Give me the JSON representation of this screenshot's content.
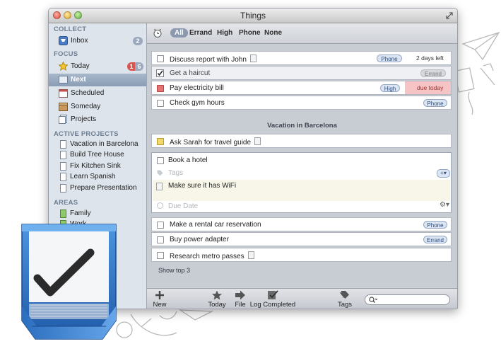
{
  "window": {
    "title": "Things"
  },
  "sidebar": {
    "collect_header": "COLLECT",
    "inbox": {
      "label": "Inbox",
      "count": "2"
    },
    "focus_header": "FOCUS",
    "today": {
      "label": "Today",
      "overdue": "1",
      "count": "6"
    },
    "next": {
      "label": "Next"
    },
    "scheduled": {
      "label": "Scheduled"
    },
    "someday": {
      "label": "Someday"
    },
    "projects": {
      "label": "Projects"
    },
    "active_projects_header": "ACTIVE PROJECTS",
    "active_projects": [
      "Vacation in Barcelona",
      "Build Tree House",
      "Fix Kitchen Sink",
      "Learn Spanish",
      "Prepare Presentation"
    ],
    "areas_header": "AREAS",
    "areas": [
      "Family",
      "Work"
    ]
  },
  "filters": {
    "all": "All",
    "errand": "Errand",
    "high": "High",
    "phone": "Phone",
    "none": "None"
  },
  "tasks": [
    {
      "title": "Discuss report with John",
      "tag": "Phone",
      "due": "2 days left"
    },
    {
      "title": "Get a haircut",
      "tag": "Errand",
      "checked": true
    },
    {
      "title": "Pay electricity bill",
      "tag": "High",
      "due": "due today"
    },
    {
      "title": "Check gym hours",
      "tag": "Phone"
    }
  ],
  "group_title": "Vacation in Barcelona",
  "group_tasks": [
    {
      "title": "Ask Sarah for travel guide"
    }
  ],
  "expanded_task": {
    "title": "Book a hotel",
    "tags_placeholder": "Tags",
    "note": "Make sure it has WiFi",
    "due_placeholder": "Due Date"
  },
  "more_tasks": [
    {
      "title": "Make a rental car reservation",
      "tag": "Phone"
    },
    {
      "title": "Buy power adapter",
      "tag": "Errand"
    },
    {
      "title": "Research metro passes"
    }
  ],
  "show_more": "Show top 3",
  "toolbar": {
    "new": "New",
    "today": "Today",
    "file": "File",
    "log_completed": "Log Completed",
    "tags": "Tags"
  },
  "colors": {
    "accent": "#8b98ad",
    "due_today": "#f6c4c4",
    "selection": "#8a9db5"
  }
}
